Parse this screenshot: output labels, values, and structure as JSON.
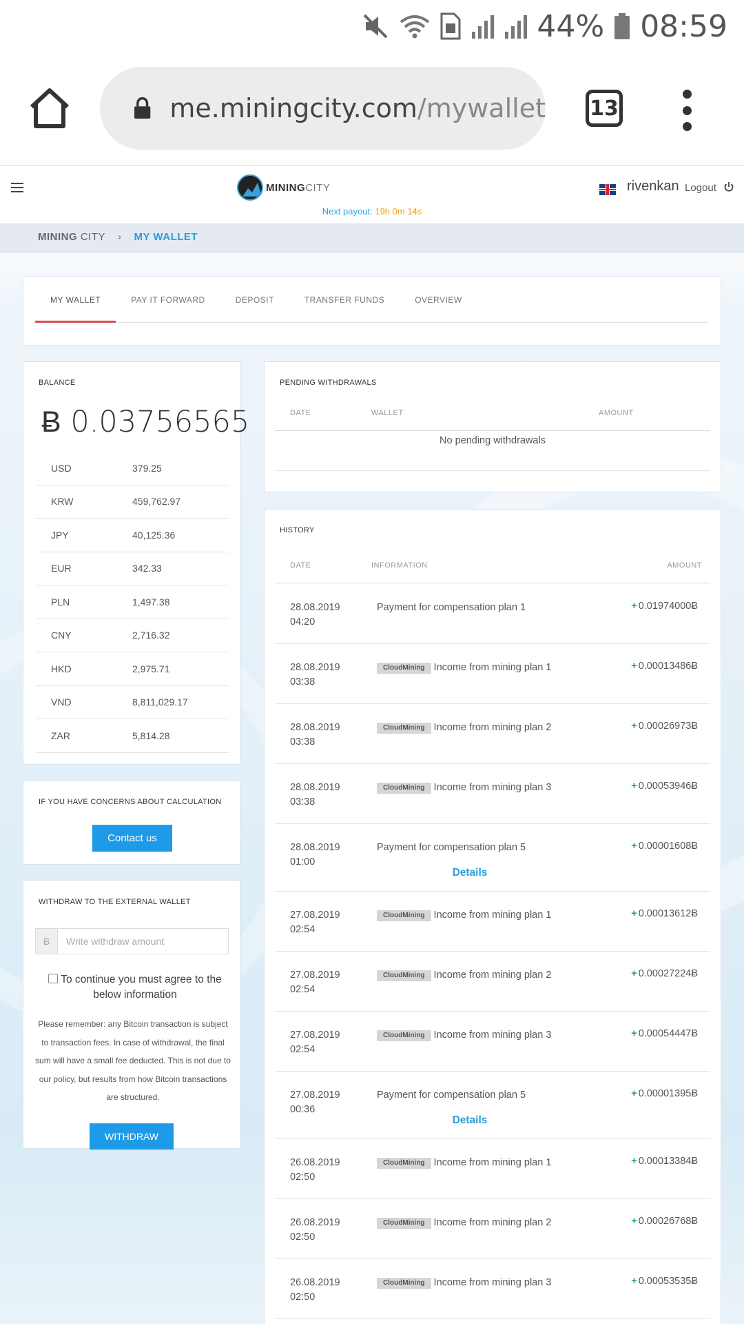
{
  "status_bar": {
    "battery_percent": "44%",
    "time": "08:59",
    "icons": [
      "mute-icon",
      "wifi-icon",
      "sim-icon",
      "signal-icon",
      "signal-icon",
      "battery-icon"
    ]
  },
  "browser": {
    "url_host": "me.miningcity.com",
    "url_path": "/mywallet",
    "tab_count": "13"
  },
  "header": {
    "logo_bold": "MINING",
    "logo_light": "CITY",
    "next_payout_label": "Next payout:",
    "next_payout_time": "19h 0m 14s",
    "username": "rivenkan",
    "logout_label": "Logout"
  },
  "breadcrumb": {
    "root_bold": "MINING",
    "root_light": "CITY",
    "separator": "›",
    "current": "MY WALLET"
  },
  "tabs": [
    {
      "label": "MY WALLET",
      "active": true
    },
    {
      "label": "PAY IT FORWARD",
      "active": false
    },
    {
      "label": "DEPOSIT",
      "active": false
    },
    {
      "label": "TRANSFER FUNDS",
      "active": false
    },
    {
      "label": "OVERVIEW",
      "active": false
    }
  ],
  "balance": {
    "title": "BALANCE",
    "amount": "Ƀ 0.03756565",
    "currencies": [
      {
        "code": "USD",
        "value": "379.25"
      },
      {
        "code": "KRW",
        "value": "459,762.97"
      },
      {
        "code": "JPY",
        "value": "40,125.36"
      },
      {
        "code": "EUR",
        "value": "342.33"
      },
      {
        "code": "PLN",
        "value": "1,497.38"
      },
      {
        "code": "CNY",
        "value": "2,716.32"
      },
      {
        "code": "HKD",
        "value": "2,975.71"
      },
      {
        "code": "VND",
        "value": "8,811,029.17"
      },
      {
        "code": "ZAR",
        "value": "5,814.28"
      }
    ]
  },
  "concern": {
    "title": "IF YOU HAVE CONCERNS ABOUT CALCULATION",
    "button": "Contact us"
  },
  "withdraw": {
    "title": "WITHDRAW TO THE EXTERNAL WALLET",
    "currency_symbol": "Ƀ",
    "placeholder": "Write withdraw amount",
    "agree_text": "To continue you must agree to the below information",
    "notice": "Please remember: any Bitcoin transaction is subject to transaction fees. In case of withdrawal, the final sum will have a small fee deducted. This is not due to our policy, but results from how Bitcoin transactions are structured.",
    "button": "WITHDRAW"
  },
  "pending": {
    "title": "PENDING WITHDRAWALS",
    "columns": [
      "DATE",
      "WALLET",
      "AMOUNT"
    ],
    "empty": "No pending withdrawals"
  },
  "history": {
    "title": "HISTORY",
    "columns": [
      "DATE",
      "INFORMATION",
      "AMOUNT"
    ],
    "details_label": "Details",
    "rows": [
      {
        "date": "28.08.2019",
        "time": "04:20",
        "badge": "",
        "info": "Payment for compensation plan 1",
        "amount": "0.01974000Ƀ",
        "details": false
      },
      {
        "date": "28.08.2019",
        "time": "03:38",
        "badge": "CloudMining",
        "info": "Income from mining plan 1",
        "amount": "0.00013486Ƀ",
        "details": false
      },
      {
        "date": "28.08.2019",
        "time": "03:38",
        "badge": "CloudMining",
        "info": "Income from mining plan 2",
        "amount": "0.00026973Ƀ",
        "details": false
      },
      {
        "date": "28.08.2019",
        "time": "03:38",
        "badge": "CloudMining",
        "info": "Income from mining plan 3",
        "amount": "0.00053946Ƀ",
        "details": false
      },
      {
        "date": "28.08.2019",
        "time": "01:00",
        "badge": "",
        "info": "Payment for compensation plan 5",
        "amount": "0.00001608Ƀ",
        "details": true
      },
      {
        "date": "27.08.2019",
        "time": "02:54",
        "badge": "CloudMining",
        "info": "Income from mining plan 1",
        "amount": "0.00013612Ƀ",
        "details": false
      },
      {
        "date": "27.08.2019",
        "time": "02:54",
        "badge": "CloudMining",
        "info": "Income from mining plan 2",
        "amount": "0.00027224Ƀ",
        "details": false
      },
      {
        "date": "27.08.2019",
        "time": "02:54",
        "badge": "CloudMining",
        "info": "Income from mining plan 3",
        "amount": "0.00054447Ƀ",
        "details": false
      },
      {
        "date": "27.08.2019",
        "time": "00:36",
        "badge": "",
        "info": "Payment for compensation plan 5",
        "amount": "0.00001395Ƀ",
        "details": true
      },
      {
        "date": "26.08.2019",
        "time": "02:50",
        "badge": "CloudMining",
        "info": "Income from mining plan 1",
        "amount": "0.00013384Ƀ",
        "details": false
      },
      {
        "date": "26.08.2019",
        "time": "02:50",
        "badge": "CloudMining",
        "info": "Income from mining plan 2",
        "amount": "0.00026768Ƀ",
        "details": false
      },
      {
        "date": "26.08.2019",
        "time": "02:50",
        "badge": "CloudMining",
        "info": "Income from mining plan 3",
        "amount": "0.00053535Ƀ",
        "details": false
      }
    ]
  },
  "colors": {
    "accent_blue": "#1e9be8",
    "active_tab_underline": "#d94a4a",
    "positive_green": "#2a9d6b",
    "payout_time": "#e8a317"
  }
}
